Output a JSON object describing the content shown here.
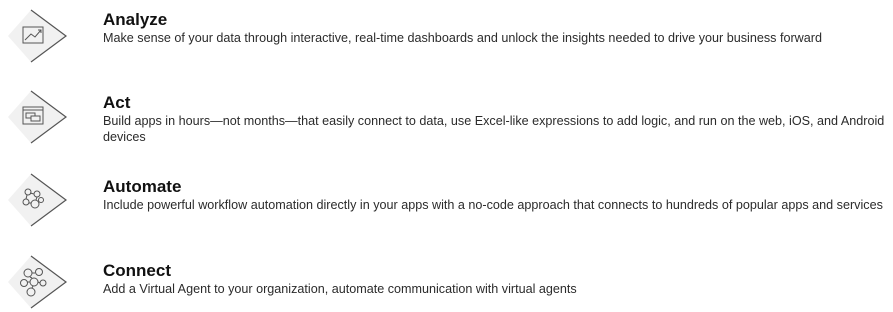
{
  "colors": {
    "icon_fill": "#f1f1f1",
    "icon_stroke": "#555555",
    "title": "#111111",
    "text": "#2b2b2b"
  },
  "features": [
    {
      "icon": "chart-line-icon",
      "title": "Analyze",
      "description": "Make sense of your data through interactive, real-time dashboards and unlock the insights needed to drive your business forward"
    },
    {
      "icon": "app-window-icon",
      "title": "Act",
      "description": "Build apps in hours—not months—that easily connect to data, use Excel-like expressions to add logic, and run on the web, iOS, and Android devices"
    },
    {
      "icon": "workflow-nodes-icon",
      "title": "Automate",
      "description": "Include powerful workflow automation directly in your apps with a no-code approach that connects to hundreds of popular apps and services"
    },
    {
      "icon": "agent-network-icon",
      "title": "Connect",
      "description": "Add a Virtual Agent to your organization, automate communication with virtual agents"
    }
  ]
}
